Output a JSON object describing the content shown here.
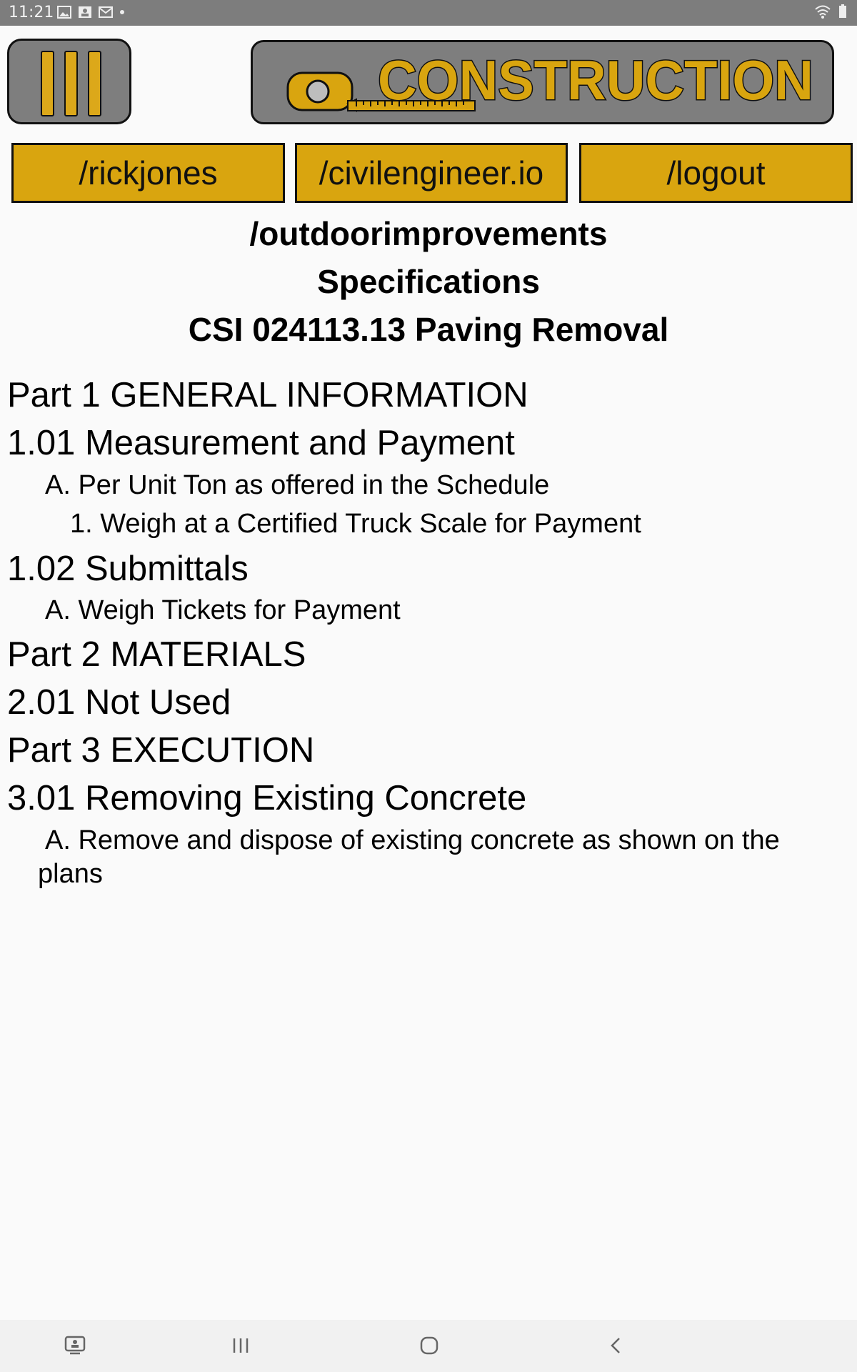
{
  "status_bar": {
    "time": "11:21",
    "left_icons": [
      "image-icon",
      "person-badge-icon",
      "mail-icon",
      "dot-icon"
    ],
    "right_icons": [
      "wifi-icon",
      "battery-icon"
    ]
  },
  "header": {
    "menu_icon": "menu-bars-icon",
    "logo_text": "CONSTRUCTION",
    "logo_icon": "tape-measure-icon",
    "accent_color": "#d9a50f",
    "panel_color": "#7e7e7e"
  },
  "nav": {
    "items": [
      {
        "label": "/rickjones"
      },
      {
        "label": "/civilengineer.io"
      },
      {
        "label": "/logout"
      }
    ]
  },
  "page": {
    "section": "/outdoorimprovements",
    "subtitle": "Specifications",
    "spec_title": "CSI 024113.13 Paving Removal"
  },
  "spec": {
    "lines": [
      "Part 1 GENERAL INFORMATION",
      "1.01 Measurement and Payment",
      "A. Per Unit Ton as offered in the Schedule",
      "1. Weigh at a Certified Truck Scale for Payment",
      "1.02 Submittals",
      "A. Weigh Tickets for Payment",
      "Part 2 MATERIALS",
      "2.01 Not Used",
      "Part 3 EXECUTION",
      "3.01 Removing Existing Concrete",
      "A. Remove and dispose of existing concrete as shown on the",
      "plans"
    ]
  },
  "system_nav": {
    "icons": [
      "screen-cast-icon",
      "recent-apps-icon",
      "home-icon",
      "back-icon"
    ]
  }
}
